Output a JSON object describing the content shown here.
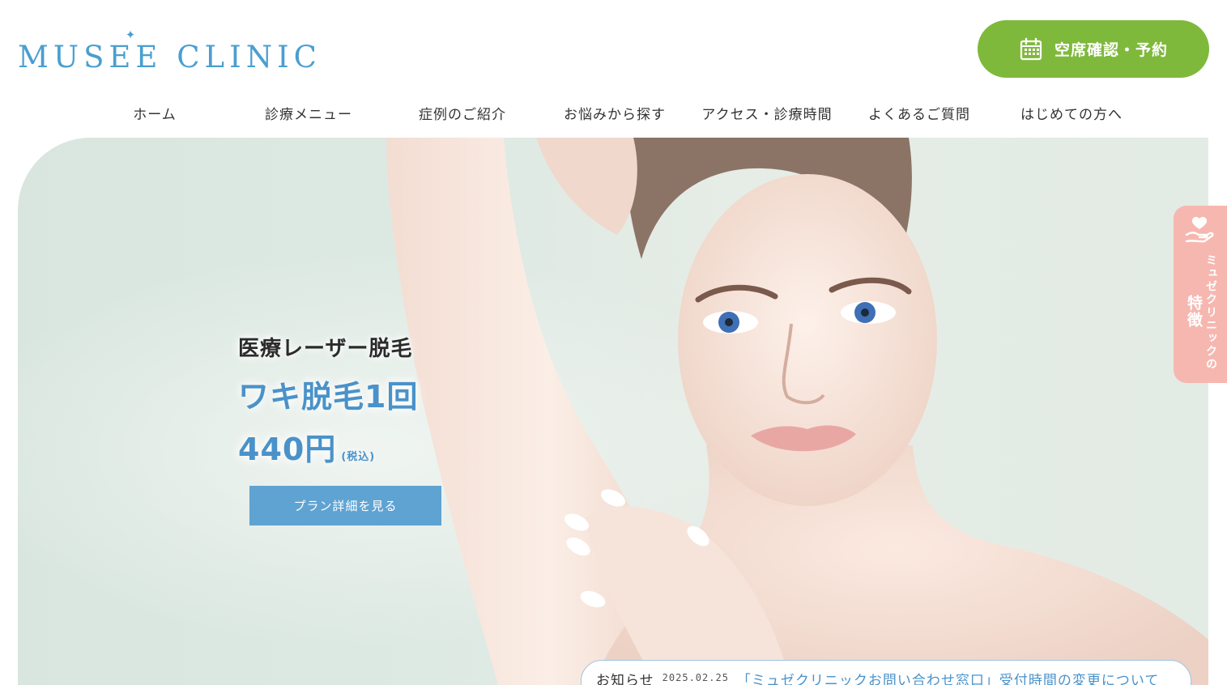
{
  "brand": {
    "logo_text": "MUSEE CLINIC"
  },
  "header": {
    "reserve_label": "空席確認・予約"
  },
  "nav": {
    "items": [
      {
        "label": "ホーム"
      },
      {
        "label": "診療メニュー"
      },
      {
        "label": "症例のご紹介"
      },
      {
        "label": "お悩みから探す"
      },
      {
        "label": "アクセス・診療時間"
      },
      {
        "label": "よくあるご質問"
      },
      {
        "label": "はじめての方へ"
      }
    ]
  },
  "hero": {
    "kicker": "医療レーザー脱毛",
    "headline": "ワキ脱毛1回",
    "price": "440円",
    "tax_note": "(税込)",
    "cta_label": "プラン詳細を見る"
  },
  "side_tab": {
    "line1": "ミュゼクリニックの",
    "line2": "特徴"
  },
  "news": {
    "label": "お知らせ",
    "date": "2025.02.25",
    "title": "「ミュゼクリニックお問い合わせ窓口」受付時間の変更について"
  },
  "colors": {
    "brand_blue": "#4a9fcf",
    "accent_green": "#7fb93c",
    "cta_blue": "#5fa3d2",
    "side_tab_pink": "#f6b7b0",
    "hero_bg": "#dde9e3"
  },
  "icons": {
    "logo_star": "sparkle-star-icon",
    "reserve": "calendar-icon",
    "side_tab": "heart-hand-icon"
  }
}
